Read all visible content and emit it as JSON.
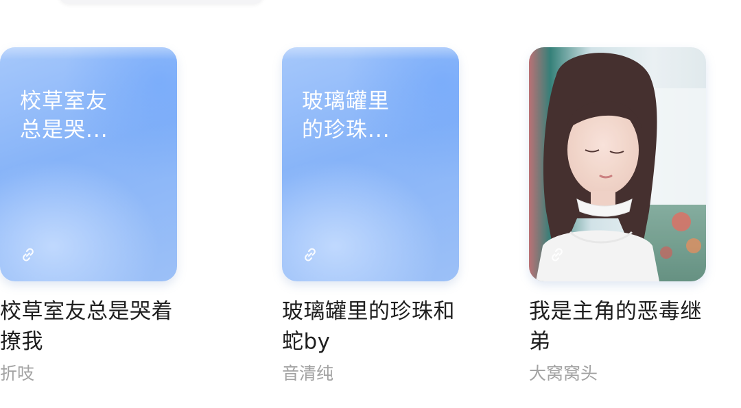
{
  "books": [
    {
      "cover_title_line1": "玻璃罐里",
      "cover_title_line2": "的珍珠...",
      "title": "玻璃罐里的珍珠和蛇by",
      "author": "音清纯",
      "cover_type": "blue-gradient",
      "icon": "link-icon"
    },
    {
      "title": "我是主角的恶毒继弟",
      "author": "大窝窝头",
      "cover_type": "photo",
      "icon": "link-icon"
    },
    {
      "cover_title_line1": "校草室友",
      "cover_title_line2": "总是哭...",
      "title": "校草室友总是哭着撩我",
      "author": "折吱",
      "cover_type": "blue-gradient",
      "icon": "link-icon"
    }
  ],
  "colors": {
    "cover_blue": "#86b3f8",
    "title_text": "#1f1f1f",
    "author_text": "#a3a3a3"
  }
}
